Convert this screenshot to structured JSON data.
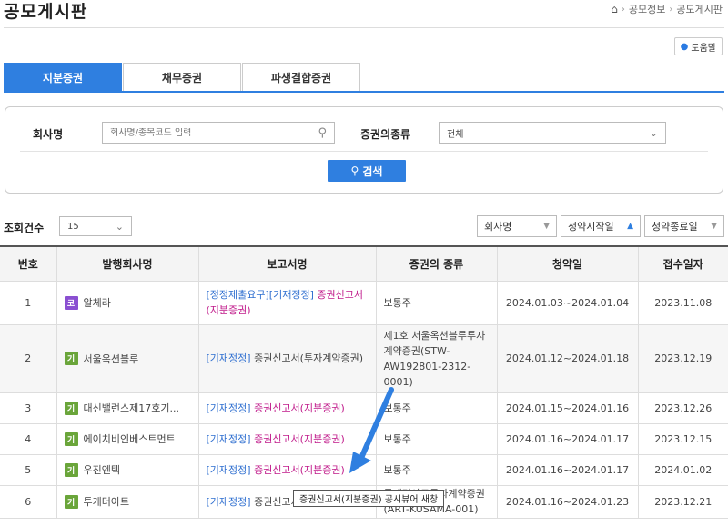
{
  "header": {
    "title": "공모게시판",
    "breadcrumb": [
      "공모정보",
      "공모게시판"
    ],
    "help": "도움말"
  },
  "tabs": [
    {
      "label": "지분증권",
      "active": true
    },
    {
      "label": "채무증권",
      "active": false
    },
    {
      "label": "파생결합증권",
      "active": false
    }
  ],
  "search": {
    "company_label": "회사명",
    "company_placeholder": "회사명/종목코드 입력",
    "type_label": "증권의종류",
    "type_value": "전체",
    "button": "검색"
  },
  "list": {
    "count_label": "조회건수",
    "count_value": "15",
    "sort": [
      {
        "label": "회사명"
      },
      {
        "label": "청약시작일"
      },
      {
        "label": "청약종료일"
      }
    ]
  },
  "table": {
    "columns": [
      "번호",
      "발행회사명",
      "보고서명",
      "증권의 종류",
      "청약일",
      "접수일자"
    ],
    "rows": [
      {
        "no": "1",
        "badge": "코",
        "company": "알체라",
        "rep_tag": "[정정제출요구][기재정정]",
        "rep_main": "증권신고서(지분증권)",
        "type": "보통주",
        "sub": "2024.01.03~2024.01.04",
        "rdate": "2023.11.08"
      },
      {
        "no": "2",
        "badge": "기",
        "company": "서울옥션블루",
        "rep_tag": "[기재정정]",
        "rep_main": "증권신고서(투자계약증권)",
        "type": "제1호 서울옥션블루투자계약증권(STW-AW192801-2312-0001)",
        "sub": "2024.01.12~2024.01.18",
        "rdate": "2023.12.19"
      },
      {
        "no": "3",
        "badge": "기",
        "company": "대신밸런스제17호기...",
        "rep_tag": "[기재정정]",
        "rep_main": "증권신고서(지분증권)",
        "type": "보통주",
        "sub": "2024.01.15~2024.01.16",
        "rdate": "2023.12.26"
      },
      {
        "no": "4",
        "badge": "기",
        "company": "에이치비인베스트먼트",
        "rep_tag": "[기재정정]",
        "rep_main": "증권신고서(지분증권)",
        "type": "보통주",
        "sub": "2024.01.16~2024.01.17",
        "rdate": "2023.12.15"
      },
      {
        "no": "5",
        "badge": "기",
        "company": "우진엔텍",
        "rep_tag": "[기재정정]",
        "rep_main": "증권신고서(지분증권)",
        "type": "보통주",
        "sub": "2024.01.16~2024.01.17",
        "rdate": "2024.01.02"
      },
      {
        "no": "6",
        "badge": "기",
        "company": "투게더아트",
        "rep_tag": "[기재정정]",
        "rep_main": "증권신고서(투자계약증권)",
        "type": "투게더아트투자계약증권 (ART-KUSAMA-001)",
        "sub": "2024.01.16~2024.01.23",
        "rdate": "2023.12.21"
      }
    ]
  },
  "tooltip": "증권신고서(지분증권) 공시뷰어 새창",
  "colors": {
    "accent": "#2f7fe0",
    "kosdaq_badge": "#8a4fd1",
    "konex_badge": "#6aa53a",
    "report_link": "#c0198a"
  }
}
